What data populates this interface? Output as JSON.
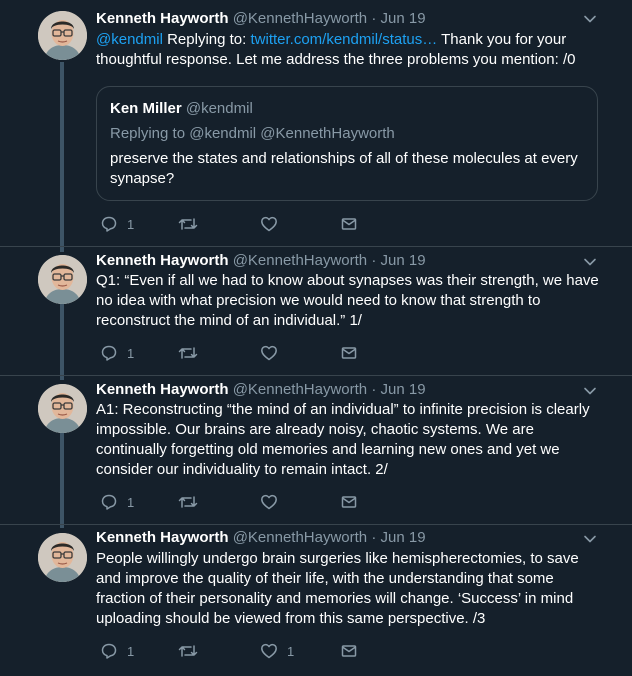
{
  "tweets": [
    {
      "name": "Kenneth Hayworth",
      "handle": "@KennethHayworth",
      "dot": "·",
      "time": "Jun 19",
      "mention": "@kendmil",
      "replying_label": "Replying to:",
      "link": "twitter.com/kendmil/status…",
      "text_after": "Thank you for your thoughtful response. Let me address the three problems you mention: /0",
      "quote": {
        "name": "Ken Miller",
        "handle": "@kendmil",
        "replying": "Replying to @kendmil @KennethHayworth",
        "text": "preserve the states and relationships of all of these molecules at every synapse?"
      },
      "replies": "1",
      "retweets": "",
      "likes": ""
    },
    {
      "name": "Kenneth Hayworth",
      "handle": "@KennethHayworth",
      "dot": "·",
      "time": "Jun 19",
      "text": "Q1: “Even if all we had to know about synapses was their strength, we have no idea with what precision we would need to know that strength to reconstruct the mind of an individual.” 1/",
      "replies": "1",
      "retweets": "",
      "likes": ""
    },
    {
      "name": "Kenneth Hayworth",
      "handle": "@KennethHayworth",
      "dot": "·",
      "time": "Jun 19",
      "text": "A1: Reconstructing “the mind of an individual” to infinite precision is clearly impossible. Our brains are already noisy, chaotic systems. We are continually forgetting old memories and learning new ones and yet we consider our individuality to remain intact. 2/",
      "replies": "1",
      "retweets": "",
      "likes": ""
    },
    {
      "name": "Kenneth Hayworth",
      "handle": "@KennethHayworth",
      "dot": "·",
      "time": "Jun 19",
      "text": "People willingly undergo brain surgeries like hemispherectomies, to save and improve the quality of their life, with the understanding that some fraction of their personality and memories will change. ‘Success’ in mind uploading should be viewed from this same perspective. /3",
      "replies": "1",
      "retweets": "",
      "likes": "1"
    }
  ],
  "colors": {
    "background": "#15202b",
    "secondary_text": "#8899a6",
    "link": "#1da1f2",
    "thread_line": "#3d5466",
    "border": "#38444d"
  },
  "icons": [
    "chevron-down-icon",
    "reply-icon",
    "retweet-icon",
    "like-icon",
    "dm-icon"
  ]
}
